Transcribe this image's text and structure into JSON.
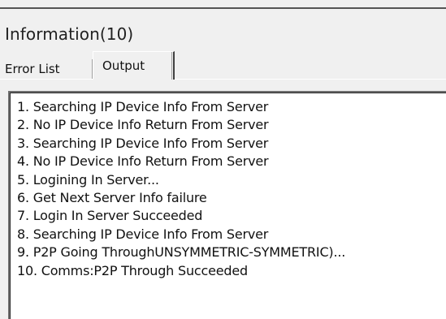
{
  "panel": {
    "title": "Information(10)"
  },
  "tabs": [
    {
      "label": "Error List",
      "active": false
    },
    {
      "label": "Output",
      "active": true
    }
  ],
  "output": {
    "lines": [
      "1. Searching IP Device Info From Server",
      "2. No IP Device Info Return From Server",
      "3. Searching IP Device Info From Server",
      "4. No IP Device Info Return From Server",
      "5. Logining In Server...",
      "6. Get Next Server Info failure",
      "7. Login In Server Succeeded",
      "8. Searching IP Device Info From Server",
      "9. P2P Going ThroughUNSYMMETRIC-SYMMETRIC)...",
      "10. Comms:P2P Through Succeeded"
    ]
  },
  "colors": {
    "background": "#f0f0f0",
    "output_background": "#ffffff",
    "text": "#111111",
    "border_dark": "#404040"
  }
}
